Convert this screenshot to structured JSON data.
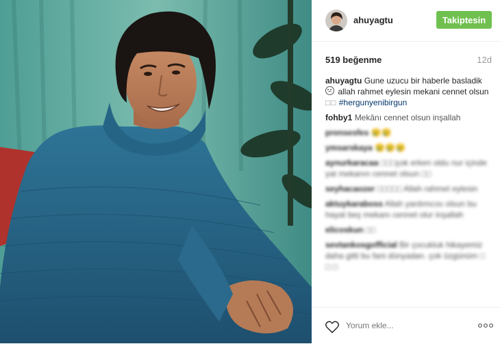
{
  "header": {
    "username": "ahuyagtu",
    "follow_label": "Takiptesin"
  },
  "stats": {
    "likes": "519 beğenme",
    "age": "12d"
  },
  "caption": {
    "username": "ahuyagtu",
    "text_1": "Gune uzucu bir haberle basladik",
    "text_2": "allah rahmet eylesin mekani cennet olsun",
    "boxes": "□□",
    "hashtag": "#hergunyenibirgun"
  },
  "comments": [
    {
      "user": "fohby1",
      "text": "Mekânı cennet olsun inşallah"
    },
    {
      "user": "prensesfes",
      "text": "😢😢"
    },
    {
      "user": "ymsarskaya",
      "text": "😢😢😢"
    },
    {
      "user": "aynurkaracaa",
      "text": "□□□çok erken oldu nur içinde yat mekanın cennet olsun □□"
    },
    {
      "user": "seyhacaozer",
      "text": "□□□□□ Allah rahmet eylesin"
    },
    {
      "user": "aktuykaraboss",
      "text": "Allah yardımcısı olsun bu hayat beş mekanı cennet olur inşallah"
    },
    {
      "user": "elicoskun",
      "text": "□□"
    },
    {
      "user": "sevtankosgofficial",
      "text": "Bir çocukluk hikayemiz daha gitti bu fani dünyadan. çok üzgünüm □ □ □"
    }
  ],
  "footer": {
    "placeholder": "Yorum ekle...",
    "icons": [
      "heart-icon",
      "more-options-icon"
    ]
  },
  "colors": {
    "follow_button": "#70c050",
    "hashtag": "#003569",
    "muted": "#999999",
    "sweater": "#2f6f94",
    "background_wall": "#5ea9a0",
    "couch": "#b0322c"
  }
}
